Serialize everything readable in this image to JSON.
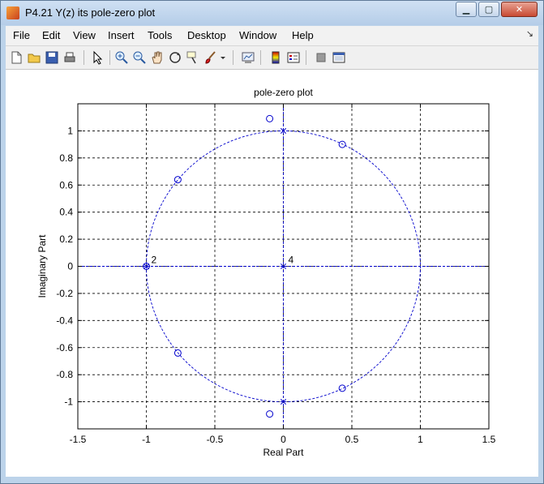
{
  "window": {
    "title": "P4.21 Y(z) its pole-zero plot",
    "controls": {
      "minimize": "▁",
      "maximize": "▢",
      "close": "✕"
    }
  },
  "menubar": {
    "items": [
      "File",
      "Edit",
      "View",
      "Insert",
      "Tools",
      "Desktop",
      "Window",
      "Help"
    ],
    "dock_symbol": "↘"
  },
  "toolbar": {
    "icons": [
      "new-figure-icon",
      "open-file-icon",
      "save-figure-icon",
      "print-figure-icon",
      "edit-plot-arrow-icon",
      "zoom-in-icon",
      "zoom-out-icon",
      "pan-hand-icon",
      "rotate-3d-icon",
      "data-cursor-icon",
      "brush-icon",
      "brush-dropdown-icon",
      "link-plot-icon",
      "insert-colorbar-icon",
      "insert-legend-icon",
      "hide-plot-tools-icon",
      "show-plot-tools-icon"
    ]
  },
  "chart_data": {
    "type": "scatter",
    "title": "pole-zero plot",
    "xlabel": "Real Part",
    "ylabel": "Imaginary Part",
    "xlim": [
      -1.5,
      1.5
    ],
    "ylim": [
      -1.2,
      1.2
    ],
    "xticks": [
      -1.5,
      -1,
      -0.5,
      0,
      0.5,
      1,
      1.5
    ],
    "xtick_labels": [
      "-1.5",
      "-1",
      "-0.5",
      "0",
      "0.5",
      "1",
      "1.5"
    ],
    "yticks": [
      -1,
      -0.8,
      -0.6,
      -0.4,
      -0.2,
      0,
      0.2,
      0.4,
      0.6,
      0.8,
      1
    ],
    "ytick_labels": [
      "-1",
      "-0.8",
      "-0.6",
      "-0.4",
      "-0.2",
      "0",
      "0.2",
      "0.4",
      "0.6",
      "0.8",
      "1"
    ],
    "grid": true,
    "unit_circle": true,
    "color": "#0000cc",
    "zeros": [
      {
        "x": -0.1,
        "y": 1.09
      },
      {
        "x": 0.43,
        "y": 0.9
      },
      {
        "x": -0.77,
        "y": 0.64
      },
      {
        "x": -1.0,
        "y": 0.0
      },
      {
        "x": -0.77,
        "y": -0.64
      },
      {
        "x": 0.43,
        "y": -0.9
      },
      {
        "x": -0.1,
        "y": -1.09
      }
    ],
    "poles": [
      {
        "x": 0.0,
        "y": 1.0
      },
      {
        "x": -1.0,
        "y": 0.0
      },
      {
        "x": 0.0,
        "y": 0.0
      },
      {
        "x": 0.0,
        "y": -1.0
      }
    ],
    "multiplicity_labels": [
      {
        "x": -1.0,
        "y": 0.0,
        "text": "2"
      },
      {
        "x": 0.0,
        "y": 0.0,
        "text": "4"
      }
    ]
  }
}
